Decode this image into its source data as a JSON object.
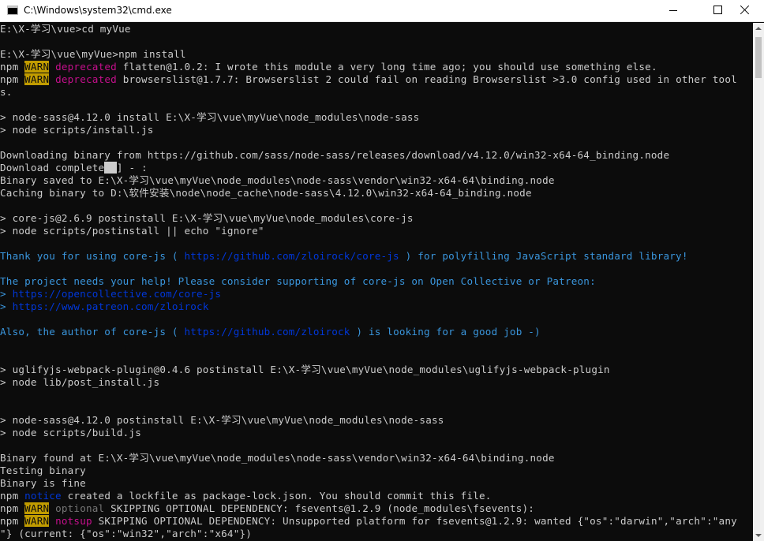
{
  "window": {
    "title": "C:\\Windows\\system32\\cmd.exe",
    "icon": "cmd-icon",
    "controls": {
      "minimize": "minimize-icon",
      "maximize": "maximize-icon",
      "close": "close-icon"
    }
  },
  "scrollbar": {
    "thumb_position_fraction": 0.0
  },
  "colors": {
    "background": "#0c0c0c",
    "text": "#cccccc",
    "warn_bg": "#c19c00",
    "magenta": "#c50f8c",
    "cyan": "#3a96dd",
    "blue": "#0037da",
    "gray": "#767676"
  },
  "console": {
    "lines": [
      [
        {
          "t": "E:\\X-学习\\vue>cd myVue",
          "c": "plain"
        }
      ],
      [
        {
          "t": "",
          "c": "plain"
        }
      ],
      [
        {
          "t": "E:\\X-学习\\vue\\myVue>npm install",
          "c": "plain"
        }
      ],
      [
        {
          "t": "npm ",
          "c": "plain"
        },
        {
          "t": "WARN",
          "c": "warn"
        },
        {
          "t": " ",
          "c": "plain"
        },
        {
          "t": "deprecated",
          "c": "magenta"
        },
        {
          "t": " flatten@1.0.2: I wrote this module a very long time ago; you should use something else.",
          "c": "plain"
        }
      ],
      [
        {
          "t": "npm ",
          "c": "plain"
        },
        {
          "t": "WARN",
          "c": "warn"
        },
        {
          "t": " ",
          "c": "plain"
        },
        {
          "t": "deprecated",
          "c": "magenta"
        },
        {
          "t": " browserslist@1.7.7: Browserslist 2 could fail on reading Browserslist >3.0 config used in other tool",
          "c": "plain"
        }
      ],
      [
        {
          "t": "s.",
          "c": "plain"
        }
      ],
      [
        {
          "t": "",
          "c": "plain"
        }
      ],
      [
        {
          "t": "> node-sass@4.12.0 install E:\\X-学习\\vue\\myVue\\node_modules\\node-sass",
          "c": "plain"
        }
      ],
      [
        {
          "t": "> node scripts/install.js",
          "c": "plain"
        }
      ],
      [
        {
          "t": "",
          "c": "plain"
        }
      ],
      [
        {
          "t": "Downloading binary from https://github.com/sass/node-sass/releases/download/v4.12.0/win32-x64-64_binding.node",
          "c": "plain"
        }
      ],
      [
        {
          "t": "Download complete",
          "c": "plain"
        },
        {
          "t": "██",
          "c": "cursor"
        },
        {
          "t": "] - :",
          "c": "plain"
        }
      ],
      [
        {
          "t": "Binary saved to E:\\X-学习\\vue\\myVue\\node_modules\\node-sass\\vendor\\win32-x64-64\\binding.node",
          "c": "plain"
        }
      ],
      [
        {
          "t": "Caching binary to D:\\软件安装\\node\\node_cache\\node-sass\\4.12.0\\win32-x64-64_binding.node",
          "c": "plain"
        }
      ],
      [
        {
          "t": "",
          "c": "plain"
        }
      ],
      [
        {
          "t": "> core-js@2.6.9 postinstall E:\\X-学习\\vue\\myVue\\node_modules\\core-js",
          "c": "plain"
        }
      ],
      [
        {
          "t": "> node scripts/postinstall || echo \"ignore\"",
          "c": "plain"
        }
      ],
      [
        {
          "t": "",
          "c": "plain"
        }
      ],
      [
        {
          "t": "Thank you for using core-js ( ",
          "c": "cyan"
        },
        {
          "t": "https://github.com/zloirock/core-js",
          "c": "blue"
        },
        {
          "t": " ) for polyfilling JavaScript standard library!",
          "c": "cyan"
        }
      ],
      [
        {
          "t": "",
          "c": "plain"
        }
      ],
      [
        {
          "t": "The project needs your help! Please consider supporting of core-js on Open Collective or Patreon:",
          "c": "cyan"
        }
      ],
      [
        {
          "t": "> ",
          "c": "cyan"
        },
        {
          "t": "https://opencollective.com/core-js",
          "c": "blue"
        }
      ],
      [
        {
          "t": "> ",
          "c": "cyan"
        },
        {
          "t": "https://www.patreon.com/zloirock",
          "c": "blue"
        }
      ],
      [
        {
          "t": "",
          "c": "plain"
        }
      ],
      [
        {
          "t": "Also, the author of core-js ( ",
          "c": "cyan"
        },
        {
          "t": "https://github.com/zloirock",
          "c": "blue"
        },
        {
          "t": " ) is looking for a good job -)",
          "c": "cyan"
        }
      ],
      [
        {
          "t": "",
          "c": "plain"
        }
      ],
      [
        {
          "t": "",
          "c": "plain"
        }
      ],
      [
        {
          "t": "> uglifyjs-webpack-plugin@0.4.6 postinstall E:\\X-学习\\vue\\myVue\\node_modules\\uglifyjs-webpack-plugin",
          "c": "plain"
        }
      ],
      [
        {
          "t": "> node lib/post_install.js",
          "c": "plain"
        }
      ],
      [
        {
          "t": "",
          "c": "plain"
        }
      ],
      [
        {
          "t": "",
          "c": "plain"
        }
      ],
      [
        {
          "t": "> node-sass@4.12.0 postinstall E:\\X-学习\\vue\\myVue\\node_modules\\node-sass",
          "c": "plain"
        }
      ],
      [
        {
          "t": "> node scripts/build.js",
          "c": "plain"
        }
      ],
      [
        {
          "t": "",
          "c": "plain"
        }
      ],
      [
        {
          "t": "Binary found at E:\\X-学习\\vue\\myVue\\node_modules\\node-sass\\vendor\\win32-x64-64\\binding.node",
          "c": "plain"
        }
      ],
      [
        {
          "t": "Testing binary",
          "c": "plain"
        }
      ],
      [
        {
          "t": "Binary is fine",
          "c": "plain"
        }
      ],
      [
        {
          "t": "npm ",
          "c": "plain"
        },
        {
          "t": "notice",
          "c": "blue"
        },
        {
          "t": " created a lockfile as package-lock.json. You should commit this file.",
          "c": "plain"
        }
      ],
      [
        {
          "t": "npm ",
          "c": "plain"
        },
        {
          "t": "WARN",
          "c": "warn"
        },
        {
          "t": " ",
          "c": "plain"
        },
        {
          "t": "optional",
          "c": "gray"
        },
        {
          "t": " SKIPPING OPTIONAL DEPENDENCY: fsevents@1.2.9 (node_modules\\fsevents):",
          "c": "plain"
        }
      ],
      [
        {
          "t": "npm ",
          "c": "plain"
        },
        {
          "t": "WARN",
          "c": "warn"
        },
        {
          "t": " ",
          "c": "plain"
        },
        {
          "t": "notsup",
          "c": "magenta"
        },
        {
          "t": " SKIPPING OPTIONAL DEPENDENCY: Unsupported platform for fsevents@1.2.9: wanted {\"os\":\"darwin\",\"arch\":\"any",
          "c": "plain"
        }
      ],
      [
        {
          "t": "\"} (current: {\"os\":\"win32\",\"arch\":\"x64\"})",
          "c": "plain"
        }
      ]
    ]
  }
}
